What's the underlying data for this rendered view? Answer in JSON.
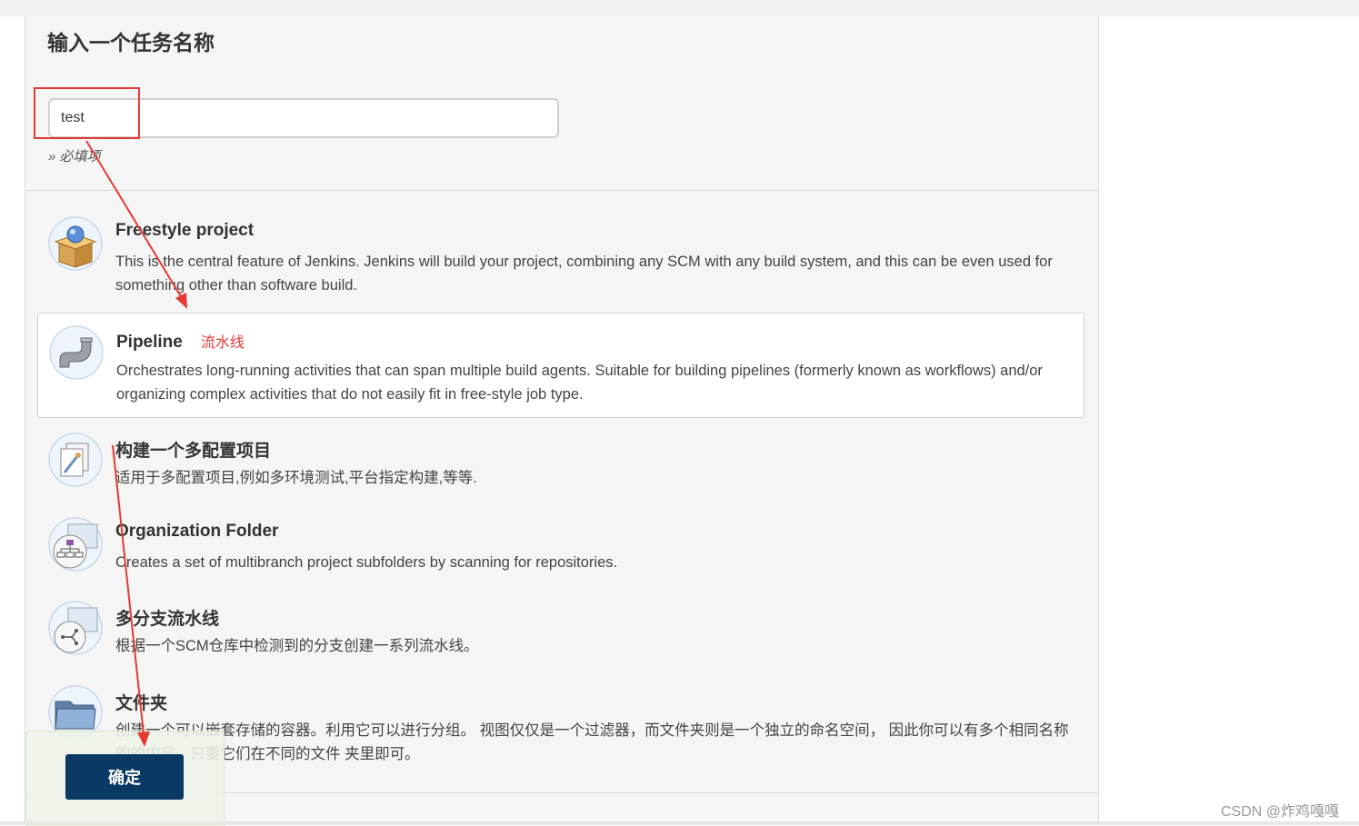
{
  "form": {
    "title": "输入一个任务名称",
    "name_value": "test",
    "required_hint": "» 必填项"
  },
  "project_types": [
    {
      "name": "Freestyle project",
      "icon": "freestyle-box-icon",
      "description": "This is the central feature of Jenkins. Jenkins will build your project, combining any SCM with any build system, and this can be even used for something other than software build."
    },
    {
      "name": "Pipeline",
      "icon": "pipeline-pipe-icon",
      "annotation": "流水线",
      "selected": true,
      "description": "Orchestrates long-running activities that can span multiple build agents. Suitable for building pipelines (formerly known as workflows) and/or organizing complex activities that do not easily fit in free-style job type."
    },
    {
      "name": "构建一个多配置项目",
      "icon": "multi-config-icon",
      "description": "适用于多配置项目,例如多环境测试,平台指定构建,等等."
    },
    {
      "name": "Organization Folder",
      "icon": "organization-folder-icon",
      "description": "Creates a set of multibranch project subfolders by scanning for repositories."
    },
    {
      "name": "多分支流水线",
      "icon": "multibranch-pipeline-icon",
      "description": "根据一个SCM仓库中检测到的分支创建一系列流水线。"
    },
    {
      "name": "文件夹",
      "icon": "folder-icon",
      "description": "创建一个可以嵌套存储的容器。利用它可以进行分组。 视图仅仅是一个过滤器，而文件夹则是一个独立的命名空间， 因此你可以有多个相同名称的的内容，只要它们在不同的文件 夹里即可。"
    }
  ],
  "footer": {
    "ok_label": "确定"
  },
  "watermark": "CSDN @炸鸡嘎嘎",
  "colors": {
    "annotation_red": "#e53935",
    "ok_button": "#0a3a64"
  }
}
